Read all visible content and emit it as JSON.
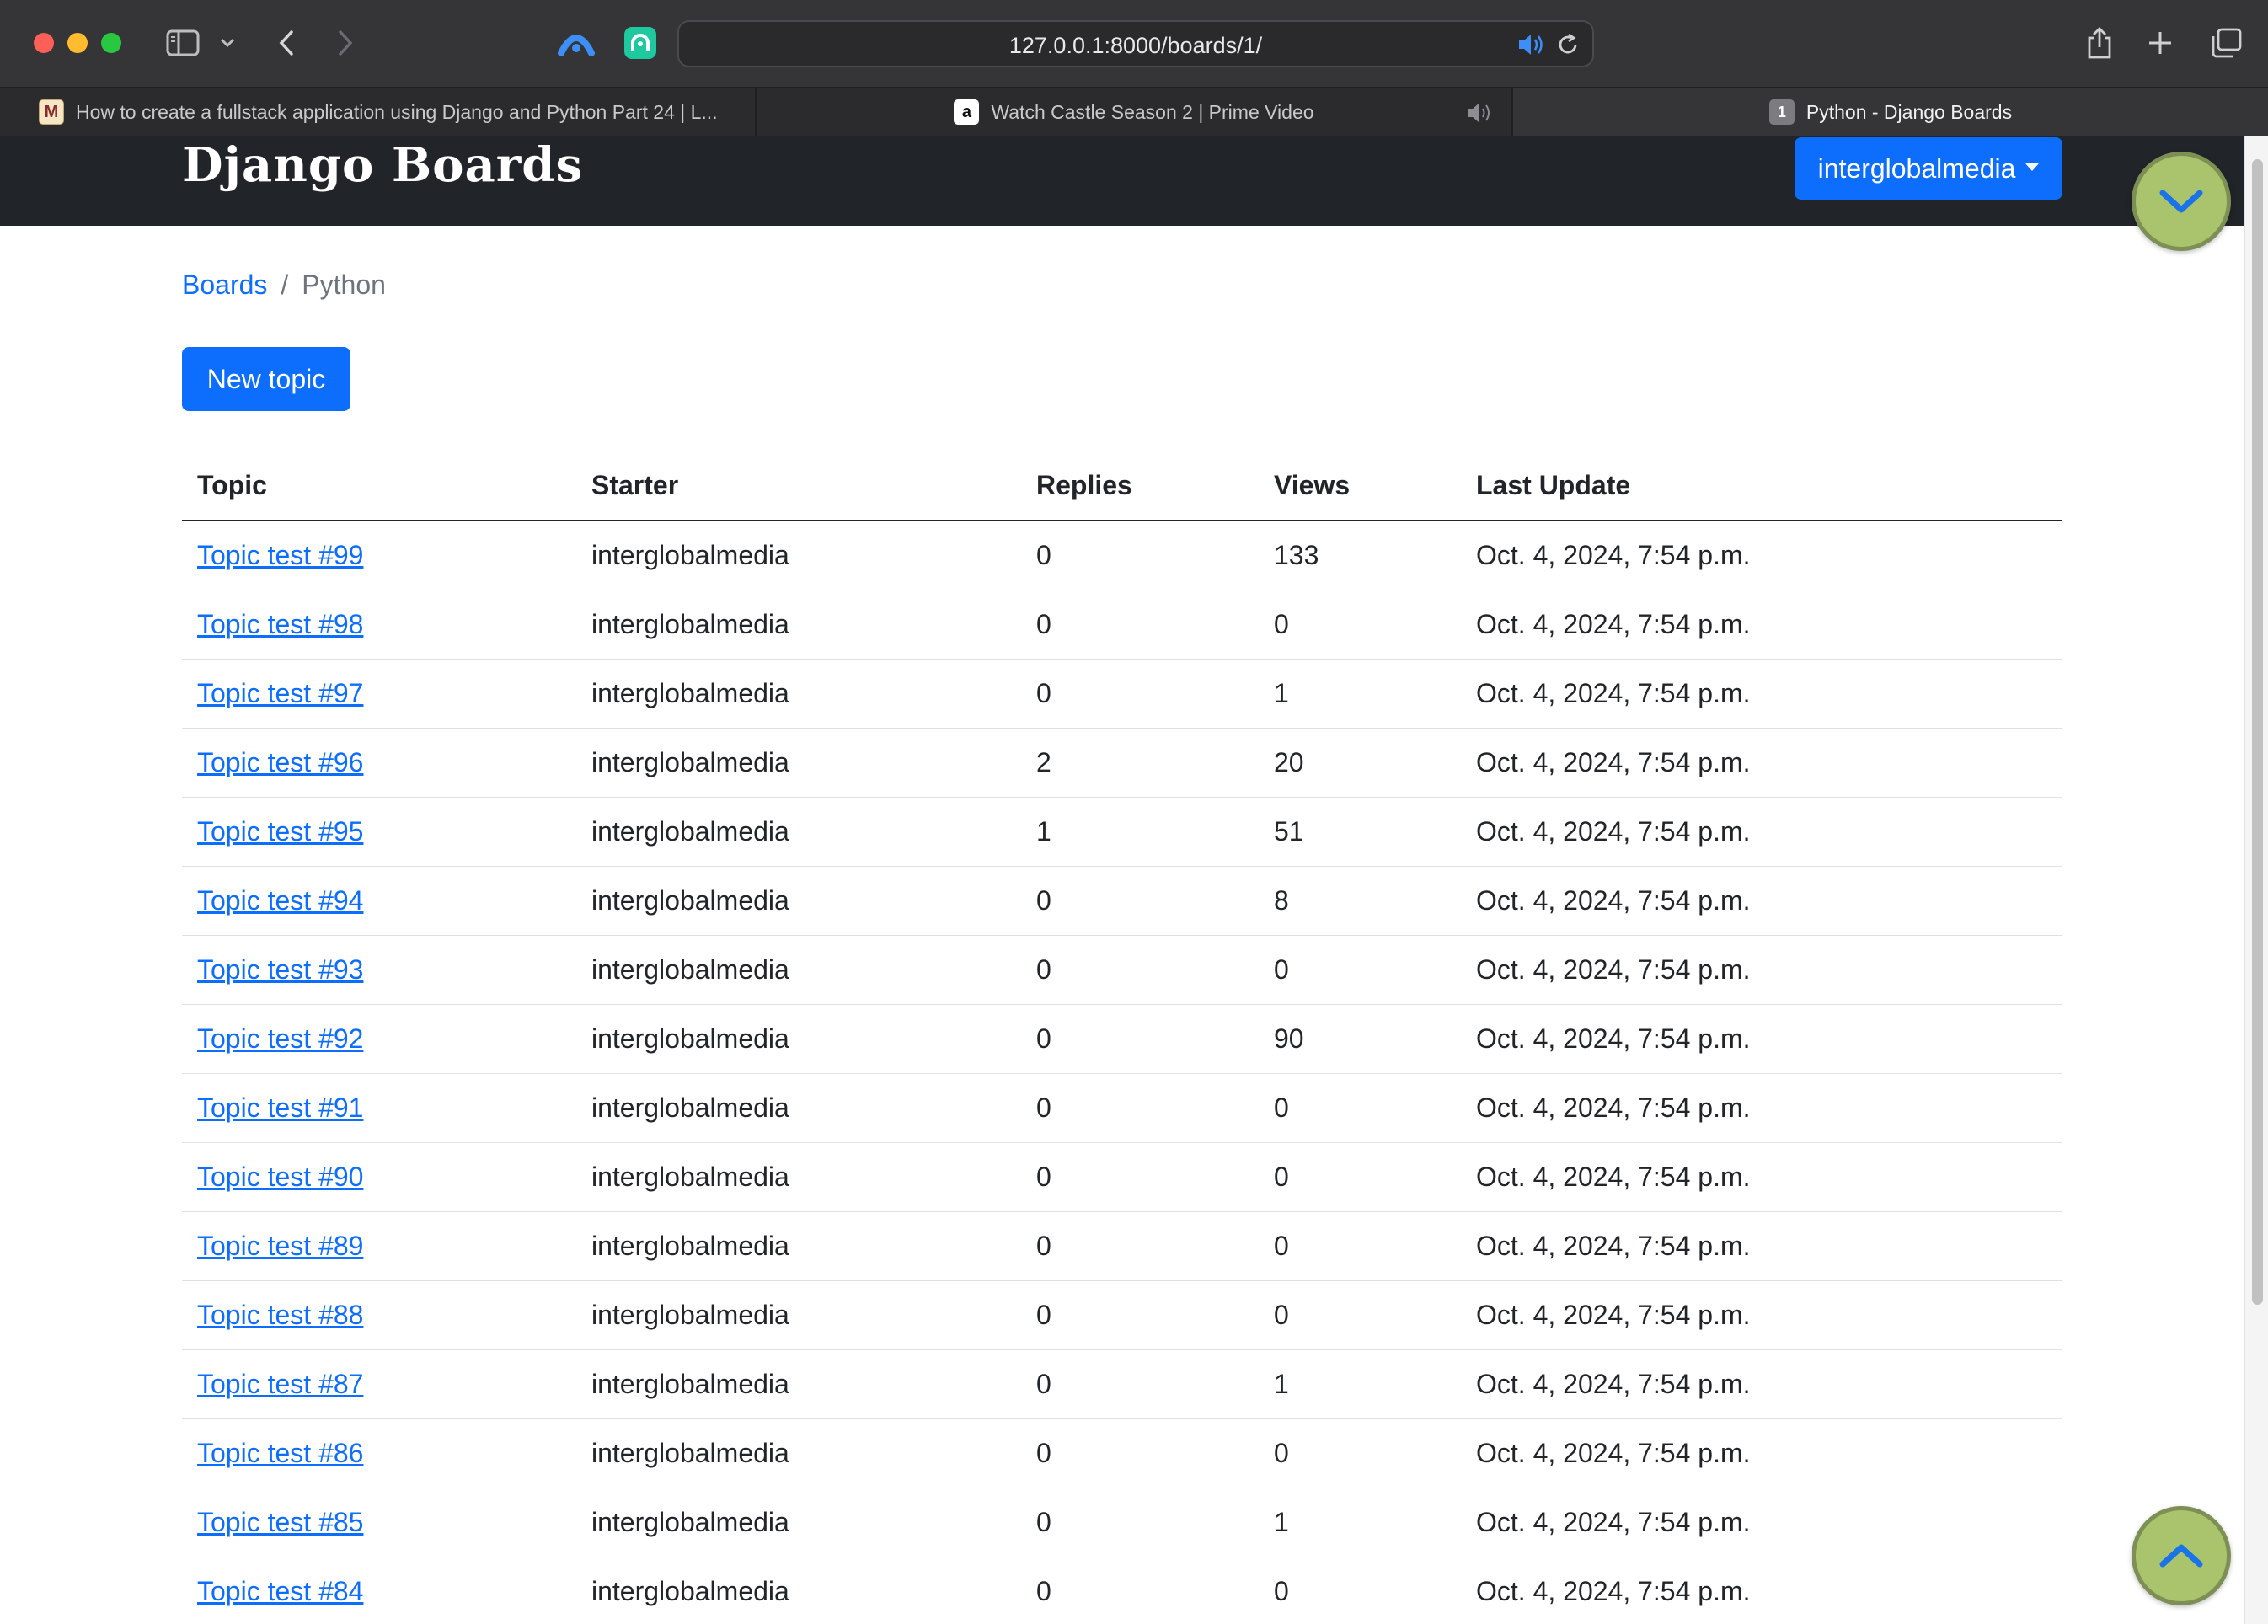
{
  "browser": {
    "url": "127.0.0.1:8000/boards/1/",
    "tabs": [
      {
        "title": "How to create a fullstack application using Django and Python Part 24 | L...",
        "favicon": "M"
      },
      {
        "title": "Watch Castle Season 2 | Prime Video",
        "favicon": "a"
      },
      {
        "title": "Python - Django Boards",
        "favicon": "1",
        "active": true
      }
    ],
    "icons": [
      "sidebar-icon",
      "chevron-down-icon",
      "back-icon",
      "forward-icon",
      "extension-icon",
      "extension-icon",
      "audio-icon",
      "reload-icon",
      "share-icon",
      "plus-icon",
      "tabs-overview-icon",
      "mute-icon"
    ]
  },
  "navbar": {
    "brand": "Django Boards",
    "user": "interglobalmedia"
  },
  "breadcrumb": {
    "boards": "Boards",
    "separator": "/",
    "current": "Python"
  },
  "actions": {
    "new_topic": "New topic"
  },
  "table": {
    "headers": {
      "topic": "Topic",
      "starter": "Starter",
      "replies": "Replies",
      "views": "Views",
      "last_update": "Last Update"
    },
    "rows": [
      {
        "topic": "Topic test #99",
        "starter": "interglobalmedia",
        "replies": "0",
        "views": "133",
        "last_update": "Oct. 4, 2024, 7:54 p.m."
      },
      {
        "topic": "Topic test #98",
        "starter": "interglobalmedia",
        "replies": "0",
        "views": "0",
        "last_update": "Oct. 4, 2024, 7:54 p.m."
      },
      {
        "topic": "Topic test #97",
        "starter": "interglobalmedia",
        "replies": "0",
        "views": "1",
        "last_update": "Oct. 4, 2024, 7:54 p.m."
      },
      {
        "topic": "Topic test #96",
        "starter": "interglobalmedia",
        "replies": "2",
        "views": "20",
        "last_update": "Oct. 4, 2024, 7:54 p.m."
      },
      {
        "topic": "Topic test #95",
        "starter": "interglobalmedia",
        "replies": "1",
        "views": "51",
        "last_update": "Oct. 4, 2024, 7:54 p.m."
      },
      {
        "topic": "Topic test #94",
        "starter": "interglobalmedia",
        "replies": "0",
        "views": "8",
        "last_update": "Oct. 4, 2024, 7:54 p.m."
      },
      {
        "topic": "Topic test #93",
        "starter": "interglobalmedia",
        "replies": "0",
        "views": "0",
        "last_update": "Oct. 4, 2024, 7:54 p.m."
      },
      {
        "topic": "Topic test #92",
        "starter": "interglobalmedia",
        "replies": "0",
        "views": "90",
        "last_update": "Oct. 4, 2024, 7:54 p.m."
      },
      {
        "topic": "Topic test #91",
        "starter": "interglobalmedia",
        "replies": "0",
        "views": "0",
        "last_update": "Oct. 4, 2024, 7:54 p.m."
      },
      {
        "topic": "Topic test #90",
        "starter": "interglobalmedia",
        "replies": "0",
        "views": "0",
        "last_update": "Oct. 4, 2024, 7:54 p.m."
      },
      {
        "topic": "Topic test #89",
        "starter": "interglobalmedia",
        "replies": "0",
        "views": "0",
        "last_update": "Oct. 4, 2024, 7:54 p.m."
      },
      {
        "topic": "Topic test #88",
        "starter": "interglobalmedia",
        "replies": "0",
        "views": "0",
        "last_update": "Oct. 4, 2024, 7:54 p.m."
      },
      {
        "topic": "Topic test #87",
        "starter": "interglobalmedia",
        "replies": "0",
        "views": "1",
        "last_update": "Oct. 4, 2024, 7:54 p.m."
      },
      {
        "topic": "Topic test #86",
        "starter": "interglobalmedia",
        "replies": "0",
        "views": "0",
        "last_update": "Oct. 4, 2024, 7:54 p.m."
      },
      {
        "topic": "Topic test #85",
        "starter": "interglobalmedia",
        "replies": "0",
        "views": "1",
        "last_update": "Oct. 4, 2024, 7:54 p.m."
      },
      {
        "topic": "Topic test #84",
        "starter": "interglobalmedia",
        "replies": "0",
        "views": "0",
        "last_update": "Oct. 4, 2024, 7:54 p.m."
      }
    ]
  },
  "floating_buttons": {
    "down_icon": "chevron-down-icon",
    "up_icon": "chevron-up-icon"
  },
  "colors": {
    "primary": "#0d6efd",
    "navbar": "#212529",
    "float_button": "#a9c46c"
  }
}
